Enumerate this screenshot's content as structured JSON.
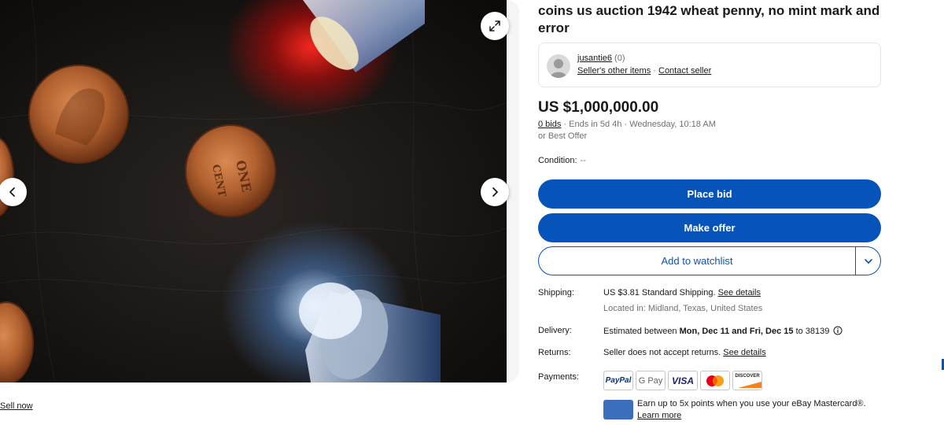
{
  "gallery": {
    "prev_label": "Previous image",
    "next_label": "Next image",
    "expand_label": "Expand image"
  },
  "sell_now": "Sell now",
  "listing": {
    "title": "coins us auction 1942 wheat penny, no mint mark and error",
    "seller": {
      "name": "jusantie6",
      "feedback": "(0)",
      "other_items": "Seller's other items",
      "separator": "·",
      "contact": "Contact seller"
    },
    "price": "US $1,000,000.00",
    "bids": "0 bids",
    "ends": "· Ends in 5d 4h · Wednesday, 10:18 AM",
    "best_offer": "or Best Offer",
    "condition_label": "Condition:",
    "condition_value": "--"
  },
  "buttons": {
    "place_bid": "Place bid",
    "make_offer": "Make offer",
    "watchlist": "Add to watchlist"
  },
  "shipping": {
    "label": "Shipping:",
    "value": "US $3.81 Standard Shipping.",
    "details_link": "See details",
    "location": "Located in: Midland, Texas, United States"
  },
  "delivery": {
    "label": "Delivery:",
    "value_pre": "Estimated between ",
    "date_range": "Mon, Dec 11 and Fri, Dec 15",
    "value_post": " to 38139"
  },
  "returns": {
    "label": "Returns:",
    "value": "Seller does not accept returns.",
    "details_link": "See details"
  },
  "payments": {
    "label": "Payments:",
    "methods": [
      "PayPal",
      "G Pay",
      "VISA",
      "Mastercard",
      "DISCOVER"
    ],
    "promo_text": "Earn up to 5x points when you use your eBay Mastercard®.",
    "promo_link": "Learn more"
  },
  "colors": {
    "primary_blue": "#0654ba",
    "text": "#191919",
    "muted": "#707070"
  },
  "icons": [
    "chevron-left-icon",
    "chevron-right-icon",
    "expand-icon",
    "chevron-down-icon",
    "info-icon",
    "avatar-icon"
  ]
}
